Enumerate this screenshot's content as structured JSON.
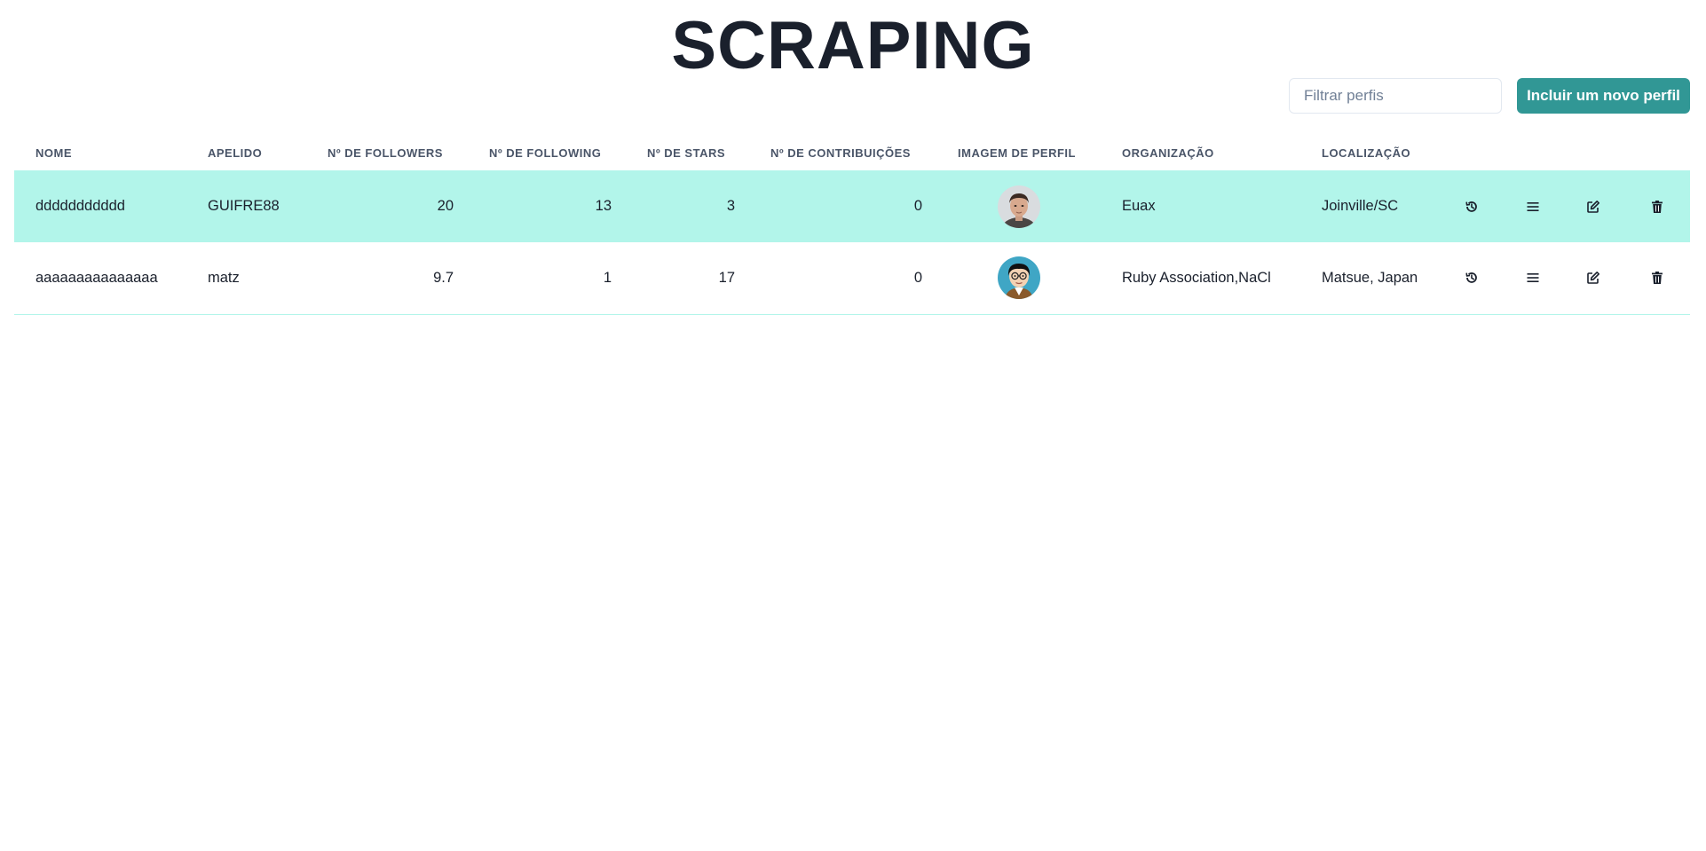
{
  "header": {
    "title": "SCRAPING",
    "filter_placeholder": "Filtrar perfis",
    "add_button_label": "Incluir um novo perfil"
  },
  "table": {
    "columns": [
      "Nome",
      "Apelido",
      "Nº de Followers",
      "Nº de Following",
      "Nº de Stars",
      "Nº de Contribuições",
      "Imagem de Perfil",
      "Organização",
      "Localização"
    ],
    "rows": [
      {
        "nome": "ddddddddddd",
        "apelido": "GUIFRE88",
        "followers": "20",
        "following": "13",
        "stars": "3",
        "contribuicoes": "0",
        "avatar": "profile-photo",
        "organizacao": "Euax",
        "localizacao": "Joinville/SC"
      },
      {
        "nome": "aaaaaaaaaaaaaaa",
        "apelido": "matz",
        "followers": "9.7",
        "following": "1",
        "stars": "17",
        "contribuicoes": "0",
        "avatar": "cartoon-avatar",
        "organizacao": "Ruby Association,NaCl",
        "localizacao": "Matsue, Japan"
      }
    ],
    "row_actions": [
      "history-icon",
      "menu-icon",
      "edit-icon",
      "trash-icon"
    ]
  },
  "colors": {
    "accent": "#319795",
    "highlight_row": "#b2f5ea",
    "title": "#1a202c"
  }
}
